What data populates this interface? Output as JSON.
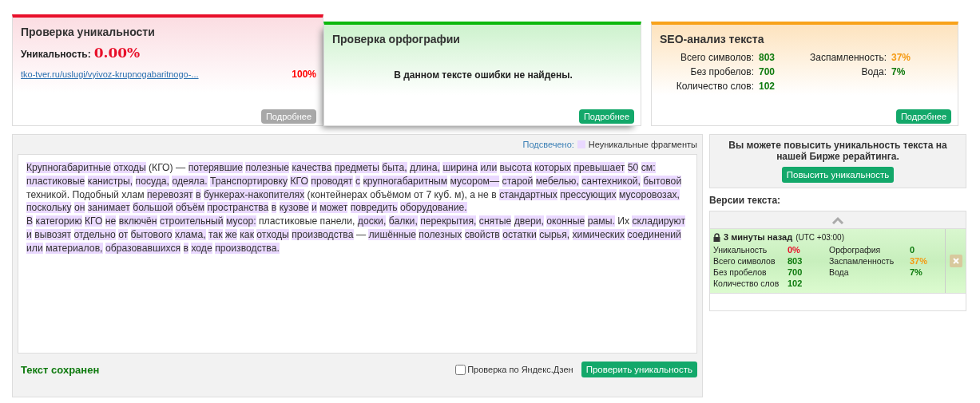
{
  "uniqueness_card": {
    "title": "Проверка уникальности",
    "label": "Уникальность:",
    "value": "0.00%",
    "source": {
      "url": "tko-tver.ru/uslugi/vyivoz-krupnogabaritnogo-...",
      "match": "100%"
    },
    "button": "Подробнее"
  },
  "spelling_card": {
    "title": "Проверка орфографии",
    "message": "В данном тексте ошибки не найдены.",
    "button": "Подробнее"
  },
  "seo_card": {
    "title": "SEO-анализ текста",
    "stats": [
      {
        "label": "Всего символов:",
        "value": "803",
        "color": "#0e7a0e"
      },
      {
        "label": "Заспамленность:",
        "value": "37%",
        "color": "#f59a12"
      },
      {
        "label": "Без пробелов:",
        "value": "700",
        "color": "#0e7a0e"
      },
      {
        "label": "Вода:",
        "value": "7%",
        "color": "#0e7a0e"
      },
      {
        "label": "Количество слов:",
        "value": "102",
        "color": "#0e7a0e"
      }
    ],
    "button": "Подробнее"
  },
  "editor": {
    "legend_label": "Подсвечено:",
    "legend_text": "Неуникальные фрагменты",
    "paragraphs": [
      [
        {
          "text": "Крупногабаритные отходы",
          "highlighted": true
        },
        {
          "text": " (КГО) — ",
          "highlighted": false
        },
        {
          "text": "потерявшие полезные качества предметы быта, длина, ширина или высота которых превышает 50 см: пластиковые канистры, посуда, одеяла. Транспортировку КГО проводят с крупногабаритным мусором— старой мебелью, сантехникой, бытовой",
          "highlighted": true
        },
        {
          "text": " техникой. Подобный хлам ",
          "highlighted": false
        },
        {
          "text": "перевозят в бункерах-накопителях",
          "highlighted": true
        },
        {
          "text": " (контейнерах объёмом от 7 куб. м), а не в ",
          "highlighted": false
        },
        {
          "text": "стандартных прессующих мусоровозах, поскольку он занимает большой объём пространства в кузове и может повредить оборудование.",
          "highlighted": true
        }
      ],
      [
        {
          "text": "В категорию КГО не включён строительный мусор:",
          "highlighted": true
        },
        {
          "text": " пластиковые панели, ",
          "highlighted": false
        },
        {
          "text": "доски, балки, перекрытия, снятые двери, оконные рамы.",
          "highlighted": true
        },
        {
          "text": " Их ",
          "highlighted": false
        },
        {
          "text": "складируют и вывозят отдельно от бытового хлама, так же как отходы производства",
          "highlighted": true
        },
        {
          "text": " — ",
          "highlighted": false
        },
        {
          "text": "лишённые полезных свойств остатки сырья, химических соединений или материалов, образовавшихся в ходе производства.",
          "highlighted": true
        }
      ]
    ],
    "status": "Текст сохранен",
    "dzen_check": {
      "label": "Проверка по Яндекс.Дзен",
      "checked": false
    },
    "check_button": "Проверить уникальность"
  },
  "promo": {
    "text": "Вы можете повысить уникальность текста на нашей Бирже рерайтинга.",
    "button": "Повысить уникальность"
  },
  "versions": {
    "title": "Версии текста:",
    "items": [
      {
        "locked": true,
        "time": "3 минуты назад",
        "timezone": "(UTC +03:00)",
        "stats": [
          {
            "label": "Уникальность",
            "value": "0%",
            "color": "#e8102a"
          },
          {
            "label": "Орфография",
            "value": "0",
            "color": "#0e7a0e"
          },
          {
            "label": "Всего символов",
            "value": "803",
            "color": "#0e7a0e"
          },
          {
            "label": "Заспамленность",
            "value": "37%",
            "color": "#f59a12"
          },
          {
            "label": "Без пробелов",
            "value": "700",
            "color": "#0e7a0e"
          },
          {
            "label": "Вода",
            "value": "7%",
            "color": "#0e7a0e"
          },
          {
            "label": "Количество слов",
            "value": "102",
            "color": "#0e7a0e"
          }
        ]
      }
    ]
  }
}
